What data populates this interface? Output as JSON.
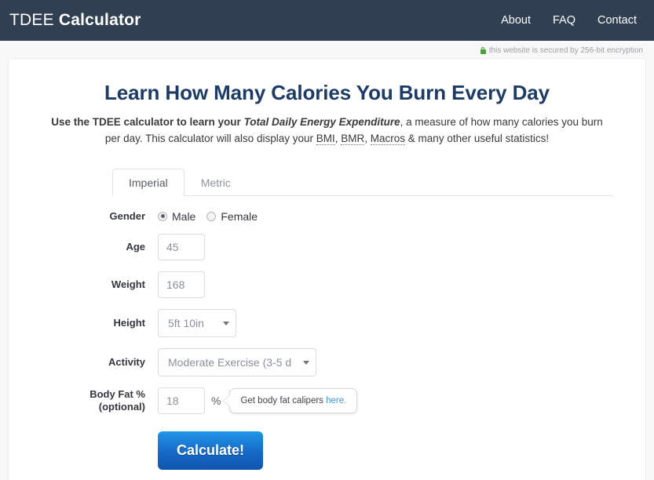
{
  "header": {
    "brand_light": "TDEE ",
    "brand_bold": "Calculator",
    "nav": [
      {
        "label": "About"
      },
      {
        "label": "FAQ"
      },
      {
        "label": "Contact"
      }
    ]
  },
  "secure": {
    "icon": "lock-icon",
    "text": "this website is secured by 256-bit encryption"
  },
  "main": {
    "title": "Learn How Many Calories You Burn Every Day",
    "desc_lead": "Use the TDEE calculator to learn your ",
    "desc_em": "Total Daily Energy Expenditure",
    "desc_rest_1": ", a measure of how many calories you burn per day. This calculator will also display your ",
    "abbr_bmi": "BMI",
    "desc_sep_1": ", ",
    "abbr_bmr": "BMR",
    "desc_sep_2": ", ",
    "abbr_macros": "Macros",
    "desc_rest_2": " & many other useful statistics!",
    "tabs": [
      {
        "label": "Imperial",
        "active": true
      },
      {
        "label": "Metric",
        "active": false
      }
    ]
  },
  "form": {
    "gender": {
      "label": "Gender",
      "options": [
        {
          "label": "Male",
          "checked": true
        },
        {
          "label": "Female",
          "checked": false
        }
      ]
    },
    "age": {
      "label": "Age",
      "value": "45",
      "placeholder": "Age"
    },
    "weight": {
      "label": "Weight",
      "value": "168",
      "placeholder": "Weight"
    },
    "height": {
      "label": "Height",
      "value": "5ft 10in"
    },
    "activity": {
      "label": "Activity",
      "value": "Moderate Exercise (3-5 d"
    },
    "bodyfat": {
      "label_line1": "Body Fat %",
      "label_line2": "(optional)",
      "value": "18",
      "unit": "%",
      "tooltip_text": "Get body fat calipers ",
      "tooltip_link": "here."
    },
    "submit": {
      "label": "Calculate!"
    }
  },
  "colors": {
    "header_bg": "#303f52",
    "title": "#1c3b66",
    "accent_button": "#1669c6",
    "link": "#4a90d9",
    "secure_lock": "#4f9e3f",
    "page_bg": "#f8f8f9"
  }
}
